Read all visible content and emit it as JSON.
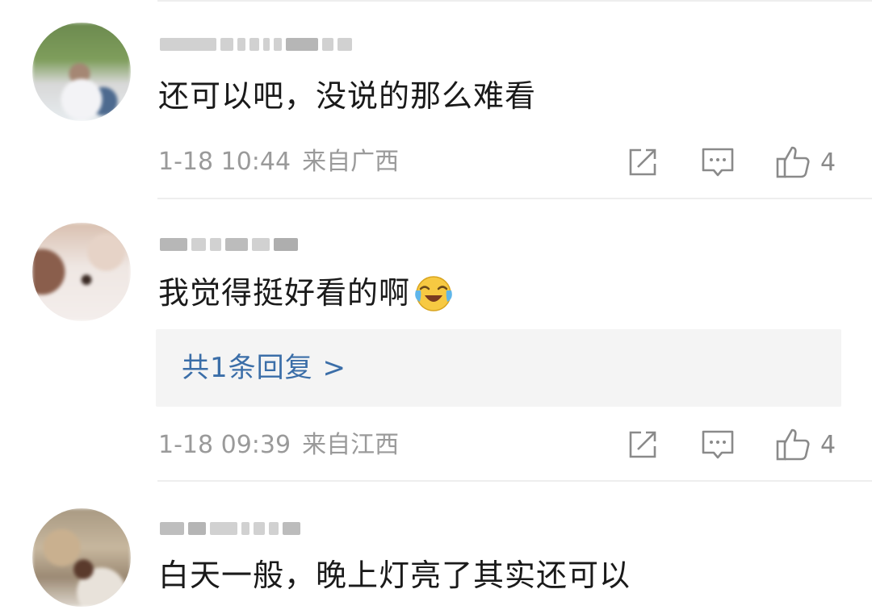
{
  "comments": [
    {
      "text": "还可以吧，没说的那么难看",
      "date": "1-18 10:44",
      "location": "来自广西",
      "likes": "4",
      "reply_link": null
    },
    {
      "text": "我觉得挺好看的啊",
      "emoji": "laughing-crying-emoji",
      "date": "1-18 09:39",
      "location": "来自江西",
      "likes": "4",
      "reply_link": "共1条回复 >"
    },
    {
      "text": "白天一般，晚上灯亮了其实还可以"
    }
  ],
  "icons": {
    "share": "share-icon",
    "reply": "comment-icon",
    "like": "thumbs-up-icon"
  },
  "colors": {
    "link": "#3b6ea8",
    "meta": "#9a9a9a",
    "reply_bg": "#f4f4f4",
    "divider": "#eeeeee"
  }
}
